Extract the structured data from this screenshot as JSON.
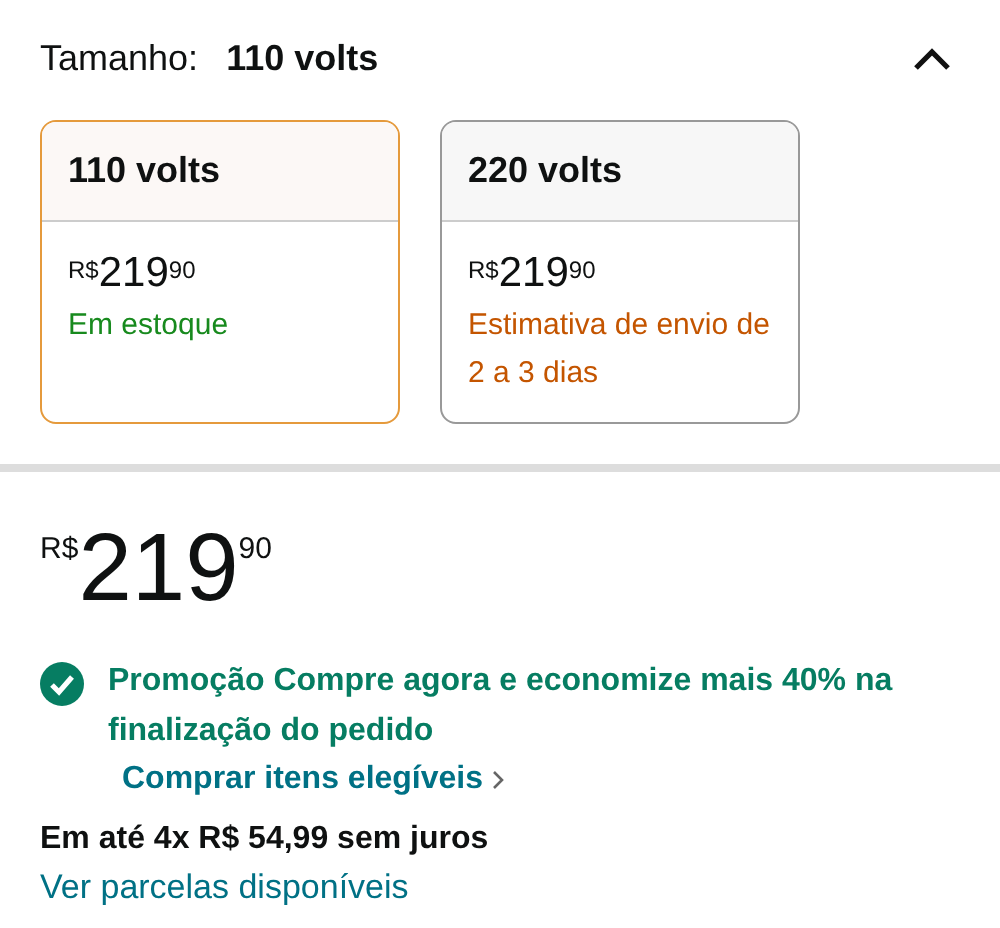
{
  "size_selector": {
    "label": "Tamanho:",
    "value": "110 volts",
    "expanded": true
  },
  "options": [
    {
      "name": "110 volts",
      "selected": true,
      "currency": "R$",
      "whole": "219",
      "fraction": "90",
      "availability": "Em estoque",
      "kind": "in_stock"
    },
    {
      "name": "220 volts",
      "selected": false,
      "currency": "R$",
      "whole": "219",
      "fraction": "90",
      "availability": "Estimativa de envio de 2 a 3 dias",
      "kind": "estimate"
    }
  ],
  "price": {
    "currency": "R$",
    "whole": "219",
    "fraction": "90"
  },
  "promotion": {
    "text": "Promoção Compre agora e economize mais 40% na finalização do pedido",
    "link": "Comprar itens elegíveis"
  },
  "installments": {
    "text": "Em até 4x R$ 54,99 sem juros",
    "link": "Ver parcelas disponíveis"
  }
}
